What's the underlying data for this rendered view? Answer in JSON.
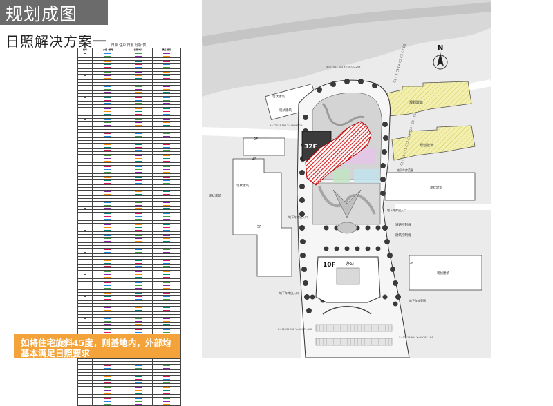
{
  "header": {
    "title": "规划成图"
  },
  "subtitle": "日照解决方案一",
  "table": {
    "title": "日照 住户 日照 分析 表",
    "headers": [
      "楼号",
      "户型 / 房号",
      "日照 时间",
      "满足 情况"
    ]
  },
  "note": {
    "text": "如将住宅旋斜45度，则基地内，外部均基本满足日照要求"
  },
  "plan": {
    "north_label": "N",
    "labels": {
      "tower_32f": "32F",
      "tower_10f": "10F",
      "office": "办公",
      "exist_1": "现状建筑",
      "exist_2": "现状建筑",
      "exist_3": "现状建筑",
      "exist_4": "现状建筑",
      "exist_5": "现状建筑",
      "exist_6": "现状建筑",
      "planned_a": "规划建筑",
      "planned_b": "规划建筑",
      "road_control": "道路控制线",
      "building_control": "建筑控制线",
      "garage_entrance_1": "地下车库出入口",
      "garage_entrance_2": "地下车库出入口",
      "garage_entrance_3": "地下车库出入口",
      "garage_range_1": "地下车库范围",
      "garage_range_2": "地下车库范围",
      "units_top": "C1 C2  C3 C4  C5 C6  C7 C8",
      "units_bottom": "C9 C10  C11 C12  C13 C14  C15 C16",
      "floor_2f_a": "2F",
      "floor_4f": "4F",
      "floor_2f_b": "2F",
      "floor_5f": "5F",
      "coord_1": "X=72512.304  Y=49720.259",
      "coord_2": "X=72514.594  Y=49697.224",
      "coord_3": "X=72619.904  Y=49797.184",
      "coord_4": "X=72935.902  Y=49775.862"
    }
  },
  "colors": {
    "title_bg": "#6b6b6b",
    "note_bg": "#f3a33a",
    "hatch_red": "#d62020",
    "hatch_yellow": "#e8e27a"
  }
}
